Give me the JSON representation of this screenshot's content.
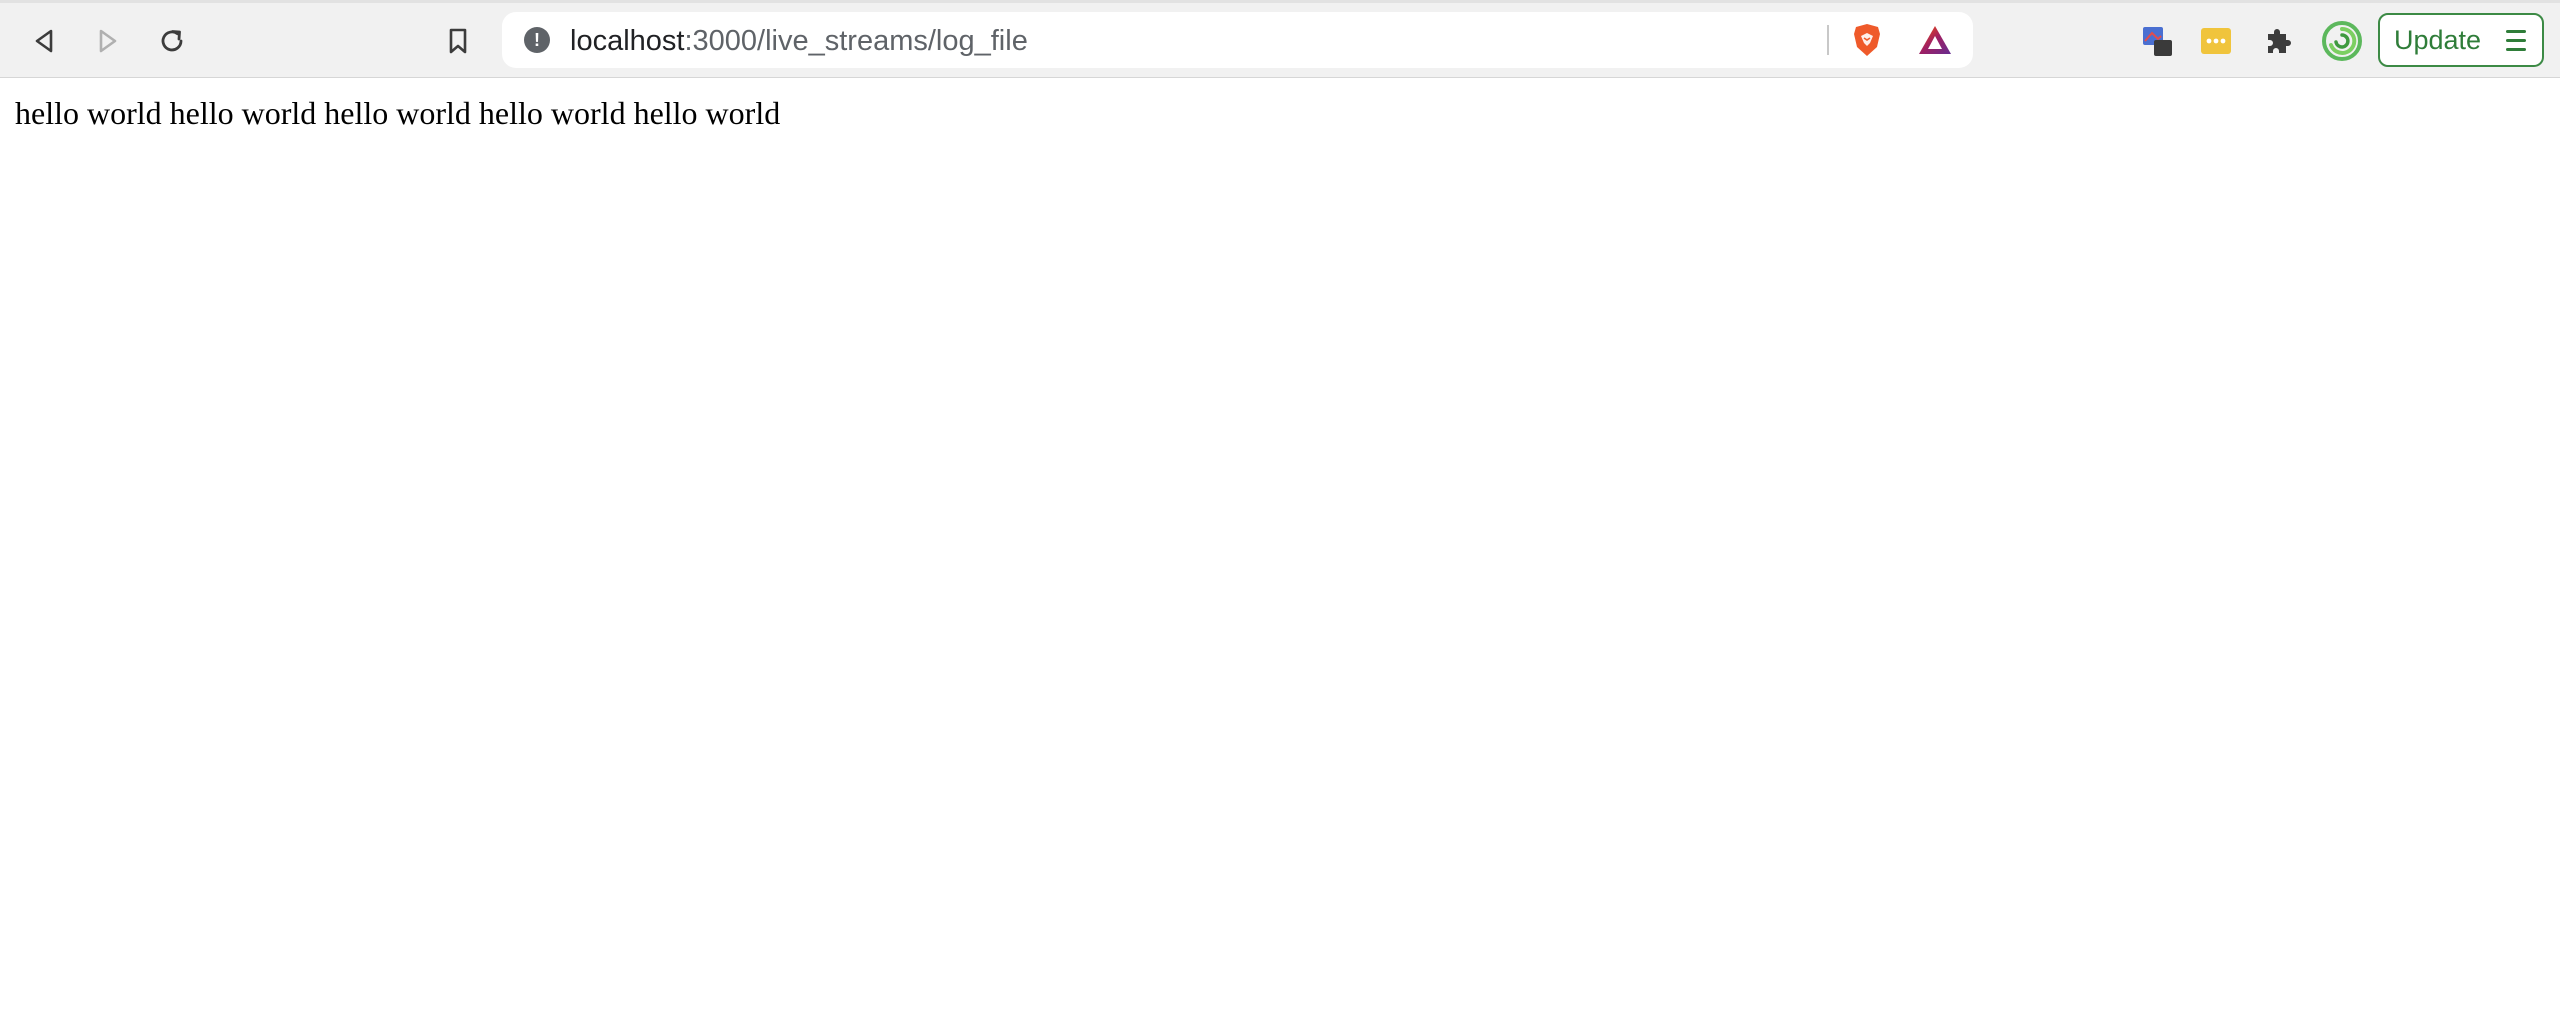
{
  "browser": {
    "nav": {
      "back_icon": "back-arrow-icon",
      "forward_icon": "forward-arrow-icon",
      "reload_icon": "reload-icon",
      "bookmark_icon": "bookmark-icon"
    },
    "omnibox": {
      "host": "localhost",
      "path": ":3000/live_streams/log_file",
      "security_icon": "info-icon",
      "security_glyph": "!",
      "shields_icon": "brave-shields-icon",
      "rewards_icon": "brave-rewards-icon"
    },
    "extensions": {
      "items": [
        "extension-screenshot-icon",
        "extension-password-icon",
        "extensions-puzzle-icon",
        "extension-green-swirl-icon"
      ]
    },
    "update": {
      "label": "Update",
      "accent": "#2f7d39"
    }
  },
  "page": {
    "body_text": "hello world hello world hello world hello world hello world"
  }
}
